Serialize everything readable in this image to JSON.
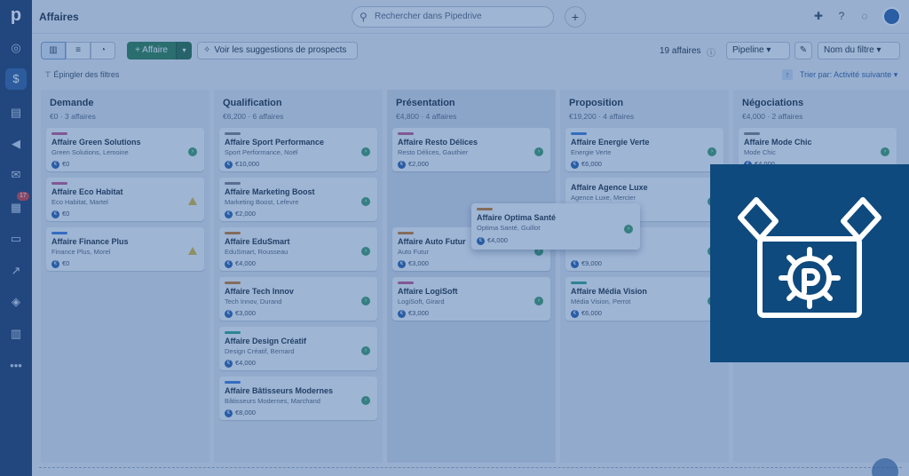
{
  "app": {
    "title": "Affaires",
    "logo_letter": "p"
  },
  "rail": {
    "icons": [
      "target-icon",
      "dollar-icon",
      "clipboard-icon",
      "megaphone-icon",
      "mail-icon",
      "calendar-icon",
      "card-icon",
      "chart-icon",
      "box-icon",
      "store-icon",
      "more-icon"
    ],
    "calendar_badge": "17"
  },
  "header": {
    "search_placeholder": "Rechercher dans Pipedrive",
    "plus": "+"
  },
  "toolbar": {
    "add_label": "+ Affaire",
    "suggestions_label": "Voir les suggestions de prospects",
    "deal_count": "19 affaires",
    "pipeline_label": "Pipeline",
    "filter_label": "Nom du filtre",
    "pin_filters": "Épingler des filtres",
    "sort_label": "Trier par: Activité suivante"
  },
  "stages": [
    {
      "name": "Demande",
      "summary": "€0 · 3 affaires",
      "cards": [
        {
          "title": "Affaire Green Solutions",
          "sub": "Green Solutions, Lemoine",
          "value": "€0",
          "bar": "#c2568e",
          "status": "ok"
        },
        {
          "title": "Affaire Eco Habitat",
          "sub": "Eco Habitat, Martel",
          "value": "€0",
          "bar": "#c2568e",
          "status": "warn"
        },
        {
          "title": "Affaire Finance Plus",
          "sub": "Finance Plus, Morel",
          "value": "€0",
          "bar": "#3d7bd6",
          "status": "warn"
        }
      ]
    },
    {
      "name": "Qualification",
      "summary": "€6,200 · 6 affaires",
      "cards": [
        {
          "title": "Affaire Sport Performance",
          "sub": "Sport Performance, Noël",
          "value": "€10,000",
          "bar": "#7a7f86",
          "status": "ok"
        },
        {
          "title": "Affaire Marketing Boost",
          "sub": "Marketing Boost, Lefevre",
          "value": "€2,000",
          "bar": "#7a7f86",
          "status": "ok"
        },
        {
          "title": "Affaire EduSmart",
          "sub": "EduSmart, Rousseau",
          "value": "€4,000",
          "bar": "#c77a2a",
          "status": "ok"
        },
        {
          "title": "Affaire Tech Innov",
          "sub": "Tech Innov, Durand",
          "value": "€3,000",
          "bar": "#c77a2a",
          "status": "ok"
        },
        {
          "title": "Affaire Design Créatif",
          "sub": "Design Créatif, Bernard",
          "value": "€4,000",
          "bar": "#2fa38a",
          "status": "ok"
        },
        {
          "title": "Affaire Bâtisseurs Modernes",
          "sub": "Bâtisseurs Modernes, Marchand",
          "value": "€8,000",
          "bar": "#3d7bd6",
          "status": "ok"
        }
      ]
    },
    {
      "name": "Présentation",
      "summary": "€4,800 · 4 affaires",
      "cards": [
        {
          "title": "Affaire Resto Délices",
          "sub": "Resto Délices, Gauthier",
          "value": "€2,000",
          "bar": "#c2568e",
          "status": "ok"
        },
        {
          "title": "Affaire Auto Futur",
          "sub": "Auto Futur",
          "value": "€3,000",
          "bar": "#c77a2a",
          "status": "ok"
        },
        {
          "title": "Affaire LogiSoft",
          "sub": "LogiSoft, Girard",
          "value": "€3,000",
          "bar": "#c2568e",
          "status": "ok"
        }
      ]
    },
    {
      "name": "Proposition",
      "summary": "€19,200 · 4 affaires",
      "cards": [
        {
          "title": "Affaire Energie Verte",
          "sub": "Energie Verte",
          "value": "€6,000",
          "bar": "#3d7bd6",
          "status": "ok"
        },
        {
          "title": "Affaire Agence Luxe",
          "sub": "Agence Luxe, Mercier",
          "value": "",
          "bar": "",
          "status": "ok"
        },
        {
          "title": "",
          "sub": "",
          "value": "€9,000",
          "bar": "",
          "status": "ok"
        },
        {
          "title": "Affaire Média Vision",
          "sub": "Média Vision, Perrot",
          "value": "€6,000",
          "bar": "#2fa38a",
          "status": "ok"
        }
      ]
    },
    {
      "name": "Négociations",
      "summary": "€4,000 · 2 affaires",
      "cards": [
        {
          "title": "Affaire Mode Chic",
          "sub": "Mode Chic",
          "value": "€4,000",
          "bar": "#7a7f86",
          "status": "ok"
        }
      ]
    }
  ],
  "dragged_card": {
    "title": "Affaire Optima Santé",
    "sub": "Optima Santé, Guillot",
    "value": "€4,000",
    "bar": "#c77a2a"
  },
  "colors": {
    "overlay": "#285aa0",
    "brand_tile": "#0e4a7e",
    "rail": "#1e3a68",
    "add_button": "#2e7d4f"
  }
}
